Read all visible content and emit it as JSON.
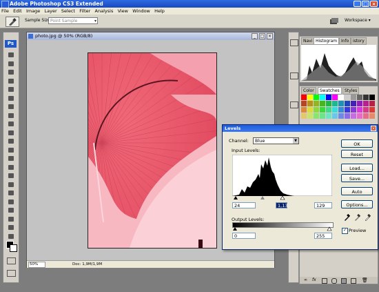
{
  "app": {
    "title": "Adobe Photoshop CS3 Extended",
    "menu": [
      "File",
      "Edit",
      "Image",
      "Layer",
      "Select",
      "Filter",
      "Analysis",
      "View",
      "Window",
      "Help"
    ]
  },
  "options_bar": {
    "sample_size_label": "Sample Size:",
    "sample_size_value": "Point Sample",
    "workspace_label": "Workspace ▾"
  },
  "toolbox": {
    "logo": "Ps"
  },
  "document": {
    "title": "photo.jpg @ 50% (RGB/8)",
    "zoom": "50%",
    "doc_info": "Doc: 1,9M/1,9M"
  },
  "panels": {
    "nav_tabs": [
      "Navi",
      "Histogram",
      "Info",
      "istory"
    ],
    "color_tabs": [
      "Color",
      "Swatches",
      "Styles"
    ]
  },
  "levels": {
    "title": "Levels",
    "channel_label": "Channel:",
    "channel_value": "Blue",
    "input_label": "Input Levels:",
    "input_values": [
      "24",
      "1,13",
      "129"
    ],
    "output_label": "Output Levels:",
    "output_values": [
      "0",
      "255"
    ],
    "buttons": [
      "OK",
      "Reset",
      "Load...",
      "Save...",
      "Auto",
      "Options..."
    ],
    "preview_label": "Preview",
    "preview_checked": true
  },
  "colors": {
    "photo_tint": "#e85a6c",
    "title_blue": "#2f6be0"
  }
}
